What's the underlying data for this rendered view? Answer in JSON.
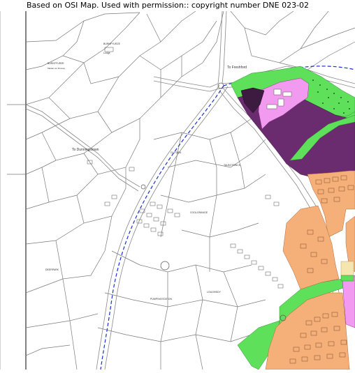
{
  "header": {
    "copyright": "Based on OSI Map. Used with permission:: copyright number DNE 023-02"
  },
  "map": {
    "labels": {
      "to_freshford": "To Freshford",
      "to_dunningstown": "To Dunningstown",
      "clifden": "CLIFDEN",
      "talbotsinch": "TALBOTSINCH",
      "coolgrange": "COOLGRANGE",
      "deerpark": "DEERPARK",
      "pumpingstation": "PUMPINGSTATION",
      "loughboy": "LOUGHBOY",
      "burnfyurze": "BURNFYURZE",
      "burnfyurze_sub": "Lodge",
      "burntfurze_north": "BURNTFURZE",
      "burntfurze_north_sub": "Maiden an Drowey"
    },
    "colors": {
      "residential_existing": "#f5b07a",
      "residential_new": "#6a2c6e",
      "open_space": "#5ee05a",
      "community": "#f29af0",
      "commercial": "#f5e6b0",
      "route_line": "#1a2fd1",
      "road_edge": "#888888"
    }
  }
}
